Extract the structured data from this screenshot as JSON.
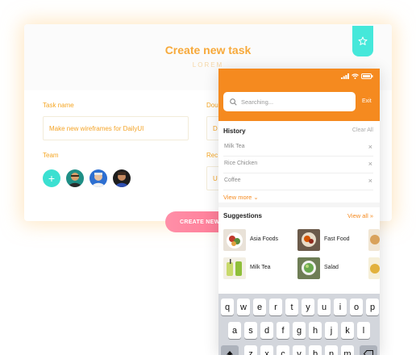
{
  "task_form": {
    "title": "Create new task",
    "subtitle": "LOREM",
    "task_name_label": "Task name",
    "task_name_value": "Make new wireframes for DailyUI",
    "due_label": "Dou",
    "due_value": "D",
    "team_label": "Team",
    "add_member_symbol": "+",
    "rec_label": "Rec",
    "rec_value": "U",
    "create_button": "CREATE NEW"
  },
  "phone": {
    "search_placeholder": "Searching...",
    "exit_label": "Exit",
    "history_title": "History",
    "clear_all_label": "Clear All",
    "history": [
      {
        "label": "Milk Tea",
        "remove": "×"
      },
      {
        "label": "Rice Chicken",
        "remove": "×"
      },
      {
        "label": "Coffee",
        "remove": "×"
      }
    ],
    "view_more_label": "View more ⌄",
    "suggestions_title": "Suggestions",
    "view_all_label": "View all »",
    "suggestions": [
      {
        "label": "Asia Foods"
      },
      {
        "label": "Fast Food"
      },
      {
        "label": "Milk Tea"
      },
      {
        "label": "Salad"
      }
    ],
    "keyboard_row1": [
      "q",
      "w",
      "e",
      "r",
      "t",
      "y",
      "u",
      "i",
      "o",
      "p"
    ],
    "keyboard_row2": [
      "a",
      "s",
      "d",
      "f",
      "g",
      "h",
      "j",
      "k",
      "l"
    ],
    "keyboard_row3": [
      "z",
      "x",
      "c",
      "v",
      "b",
      "n",
      "m"
    ]
  },
  "colors": {
    "accent_orange": "#f58a1f",
    "label_orange": "#f5a623",
    "teal": "#45e8da",
    "pink": "#ff6b87"
  }
}
